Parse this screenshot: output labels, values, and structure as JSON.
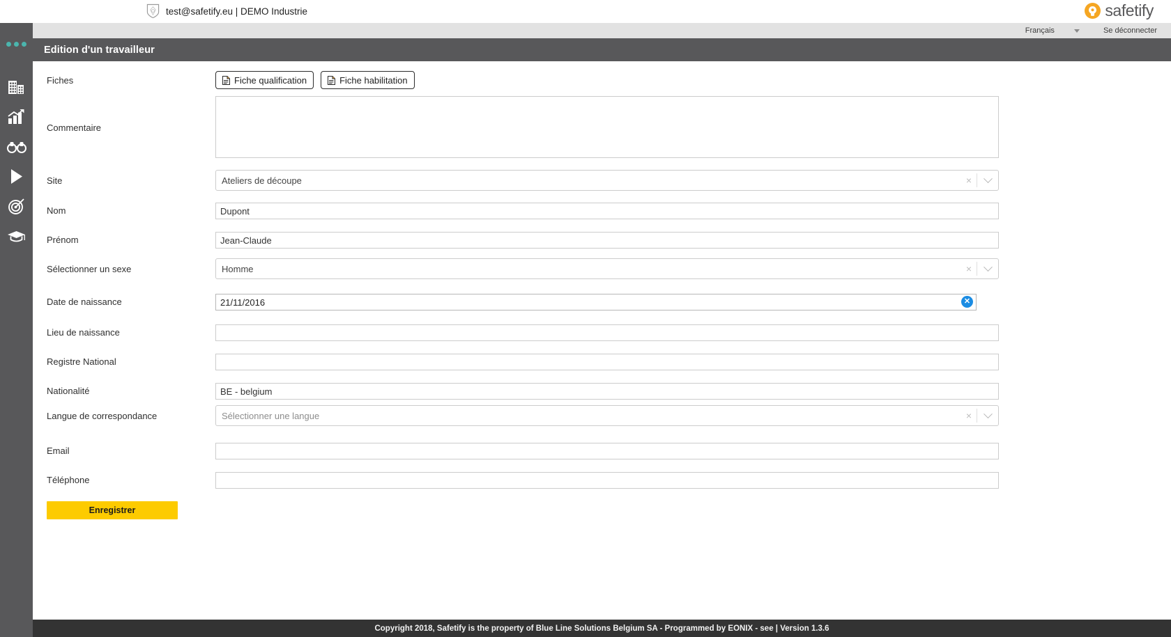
{
  "brand": {
    "account_text": "test@safetify.eu | DEMO Industrie",
    "logo_text": "safetify",
    "logo_color": "#f5a623",
    "shield_icon": "shield-crest-icon"
  },
  "topbar": {
    "language": "Français",
    "logout": "Se déconnecter"
  },
  "sidebar": {
    "dots_color": "#4bb5ad",
    "items": [
      {
        "icon": "buildings-icon",
        "name": "sidebar-item-buildings"
      },
      {
        "icon": "bar-chart-up-icon",
        "name": "sidebar-item-statistics"
      },
      {
        "icon": "binoculars-icon",
        "name": "sidebar-item-observation"
      },
      {
        "icon": "play-icon",
        "name": "sidebar-item-actions"
      },
      {
        "icon": "target-icon",
        "name": "sidebar-item-objectives"
      },
      {
        "icon": "graduation-cap-icon",
        "name": "sidebar-item-training"
      }
    ]
  },
  "page": {
    "title": "Edition d'un travailleur"
  },
  "form": {
    "fiches": {
      "label": "Fiches",
      "buttons": [
        {
          "label": "Fiche qualification",
          "icon": "document-icon"
        },
        {
          "label": "Fiche habilitation",
          "icon": "document-icon"
        }
      ]
    },
    "commentaire": {
      "label": "Commentaire",
      "value": "",
      "placeholder": ""
    },
    "site": {
      "label": "Site",
      "value": "Ateliers de découpe",
      "clear_icon": "close-icon",
      "arrow_icon": "chevron-down-icon"
    },
    "nom": {
      "label": "Nom",
      "value": "Dupont"
    },
    "prenom": {
      "label": "Prénom",
      "value": "Jean-Claude"
    },
    "sexe": {
      "label": "Sélectionner un sexe",
      "value": "Homme",
      "clear_icon": "close-icon",
      "arrow_icon": "chevron-down-icon"
    },
    "date_naissance": {
      "label": "Date de naissance",
      "value": "21/11/2016",
      "clear_icon": "clear-circle-icon",
      "clear_color": "#1b8ce3"
    },
    "lieu_naissance": {
      "label": "Lieu de naissance",
      "value": ""
    },
    "registre_national": {
      "label": "Registre National",
      "value": ""
    },
    "nationalite": {
      "label": "Nationalité",
      "value": "BE - belgium"
    },
    "langue": {
      "label": "Langue de correspondance",
      "value": "Sélectionner une langue",
      "is_placeholder": true,
      "clear_icon": "close-icon",
      "arrow_icon": "chevron-down-icon"
    },
    "email": {
      "label": "Email",
      "value": ""
    },
    "telephone": {
      "label": "Téléphone",
      "value": ""
    },
    "save": {
      "label": "Enregistrer",
      "color": "#fdcb00"
    }
  },
  "footer": {
    "text": "Copyright 2018, Safetify is the property of Blue Line Solutions Belgium SA - Programmed by EONIX - see | Version 1.3.6"
  }
}
